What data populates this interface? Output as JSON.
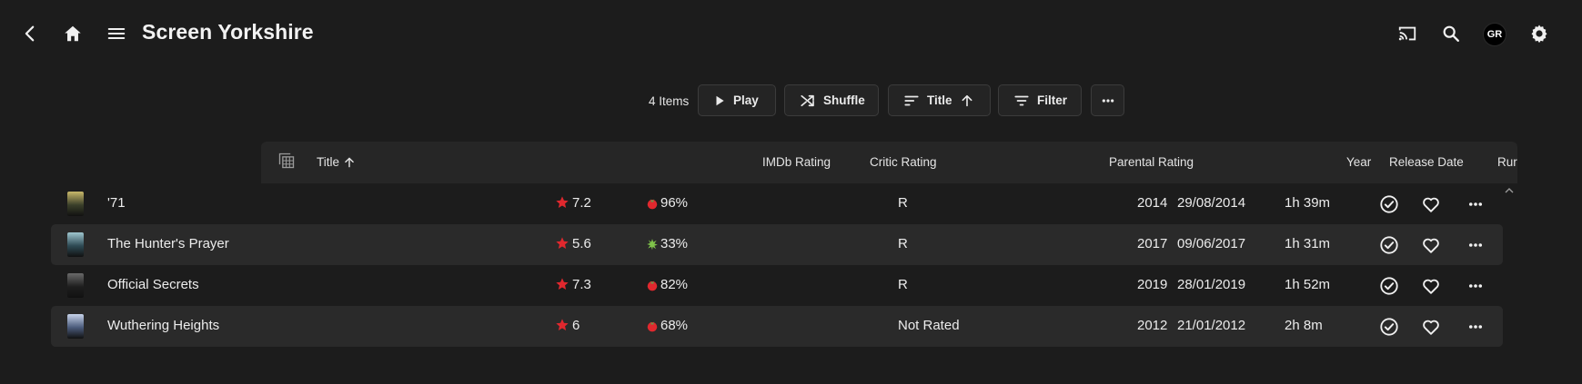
{
  "app": {
    "title": "Screen Yorkshire",
    "avatar_initials": "GR",
    "icons": [
      "back-arrow-icon",
      "home-icon",
      "menu-icon",
      "cast-icon",
      "search-icon",
      "settings-gear-icon"
    ]
  },
  "toolbar": {
    "item_count": "4 Items",
    "play_label": "Play",
    "shuffle_label": "Shuffle",
    "sort_label": "Title",
    "filter_label": "Filter"
  },
  "table": {
    "headers": {
      "title": "Title",
      "imdb": "IMDb Rating",
      "critic": "Critic Rating",
      "parental": "Parental Rating",
      "year": "Year",
      "release": "Release Date",
      "runtime": "Rur"
    },
    "rows": [
      {
        "title": "'71",
        "imdb": "7.2",
        "critic": "96%",
        "critic_icon": "fresh-tomato-icon",
        "parental": "R",
        "year": "2014",
        "release": "29/08/2014",
        "runtime": "1h 39m"
      },
      {
        "title": "The Hunter's Prayer",
        "imdb": "5.6",
        "critic": "33%",
        "critic_icon": "rotten-splat-icon",
        "parental": "R",
        "year": "2017",
        "release": "09/06/2017",
        "runtime": "1h 31m"
      },
      {
        "title": "Official Secrets",
        "imdb": "7.3",
        "critic": "82%",
        "critic_icon": "fresh-tomato-icon",
        "parental": "R",
        "year": "2019",
        "release": "28/01/2019",
        "runtime": "1h 52m"
      },
      {
        "title": "Wuthering Heights",
        "imdb": "6",
        "critic": "68%",
        "critic_icon": "fresh-tomato-icon",
        "parental": "Not Rated",
        "year": "2012",
        "release": "21/01/2012",
        "runtime": "2h 8m"
      }
    ]
  },
  "colors": {
    "background": "#1c1c1c",
    "row_alt": "#2a2a2a",
    "header_bg": "#262626",
    "star": "#e0282e",
    "tomato": "#e0282e",
    "splat": "#7fc34a"
  }
}
